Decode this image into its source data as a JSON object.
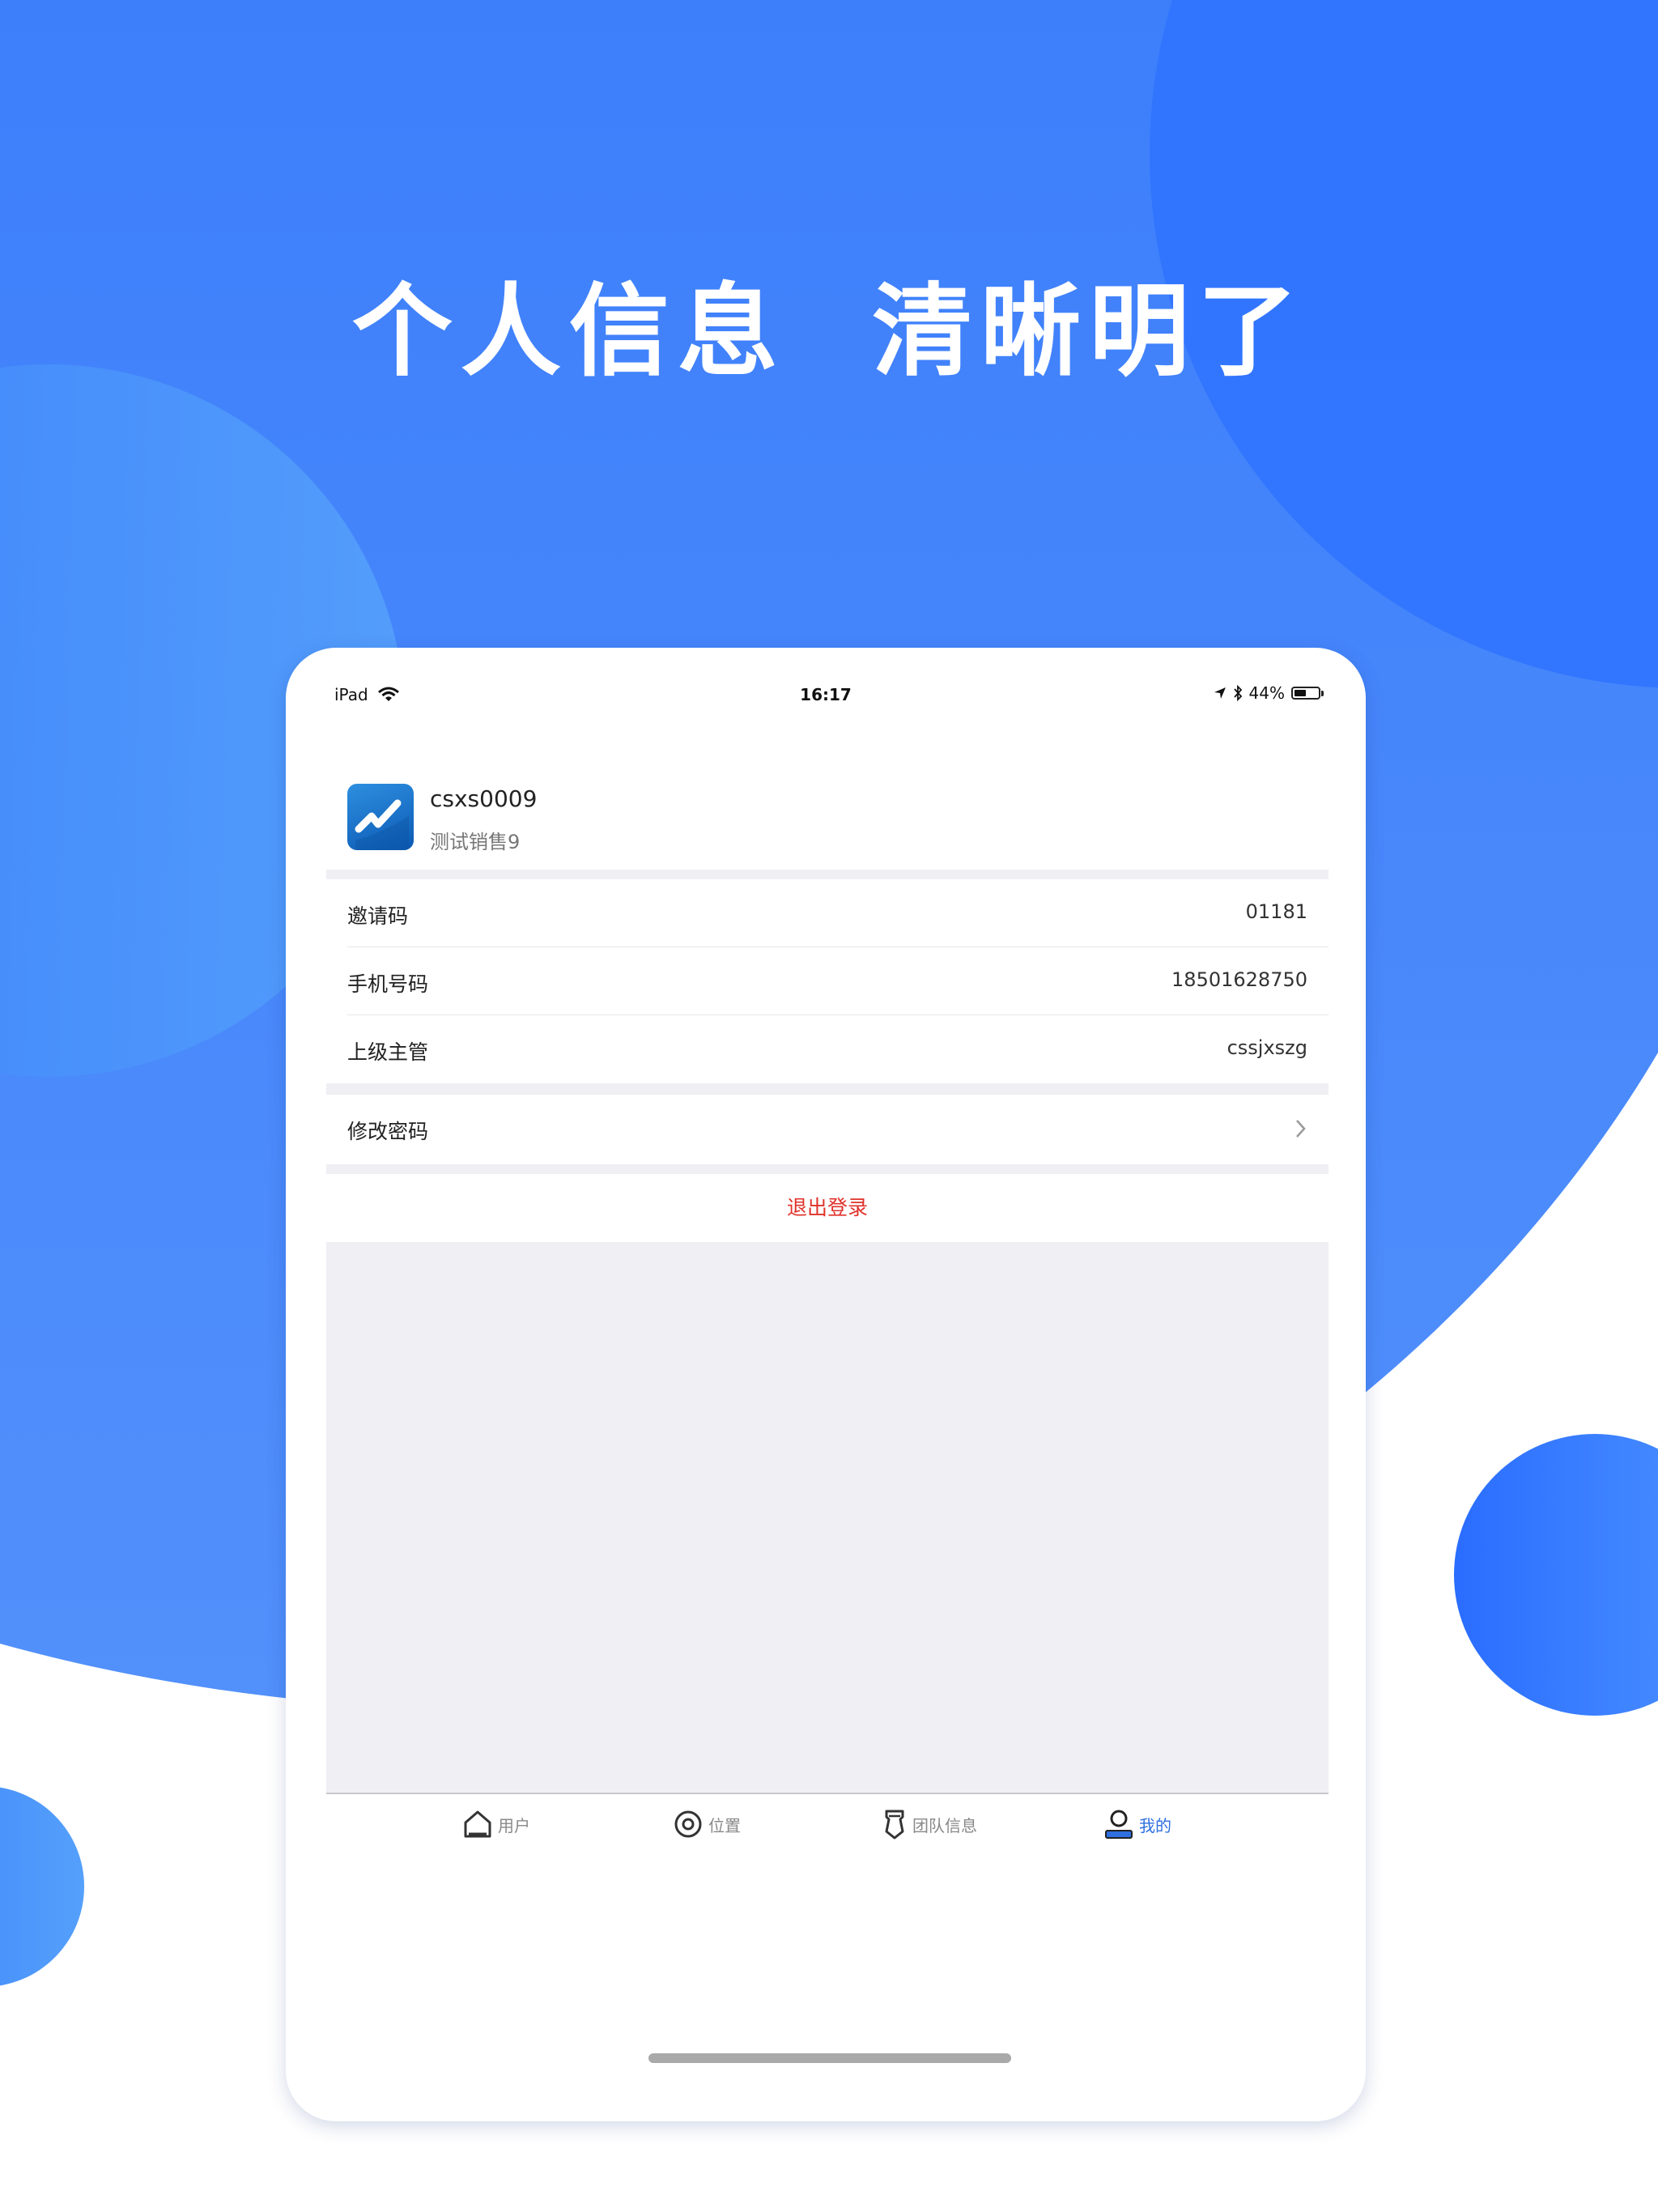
{
  "headline": "个人信息  清晰明了",
  "colors": {
    "brand_blue": "#3f82fb",
    "bubble_blue": "#2f73ff",
    "logout_red": "#e0322b",
    "tab_active": "#2f6fe0",
    "separator": "#efeff4"
  },
  "status_bar": {
    "device": "iPad",
    "time": "16:17",
    "battery": "44%",
    "battery_level": 0.44,
    "icons": [
      "wifi-icon",
      "location-arrow-icon",
      "bluetooth-icon",
      "battery-icon"
    ]
  },
  "profile": {
    "username": "csxs0009",
    "display_name": "测试销售9"
  },
  "info_rows": [
    {
      "label": "邀请码",
      "value": "01181"
    },
    {
      "label": "手机号码",
      "value": "18501628750"
    },
    {
      "label": "上级主管",
      "value": "cssjxszg"
    }
  ],
  "change_password": {
    "label": "修改密码"
  },
  "logout": {
    "label": "退出登录"
  },
  "tabs": [
    {
      "label": "用户",
      "icon": "home-icon",
      "active": false
    },
    {
      "label": "位置",
      "icon": "location-target-icon",
      "active": false
    },
    {
      "label": "团队信息",
      "icon": "team-badge-icon",
      "active": false
    },
    {
      "label": "我的",
      "icon": "profile-icon",
      "active": true
    }
  ]
}
